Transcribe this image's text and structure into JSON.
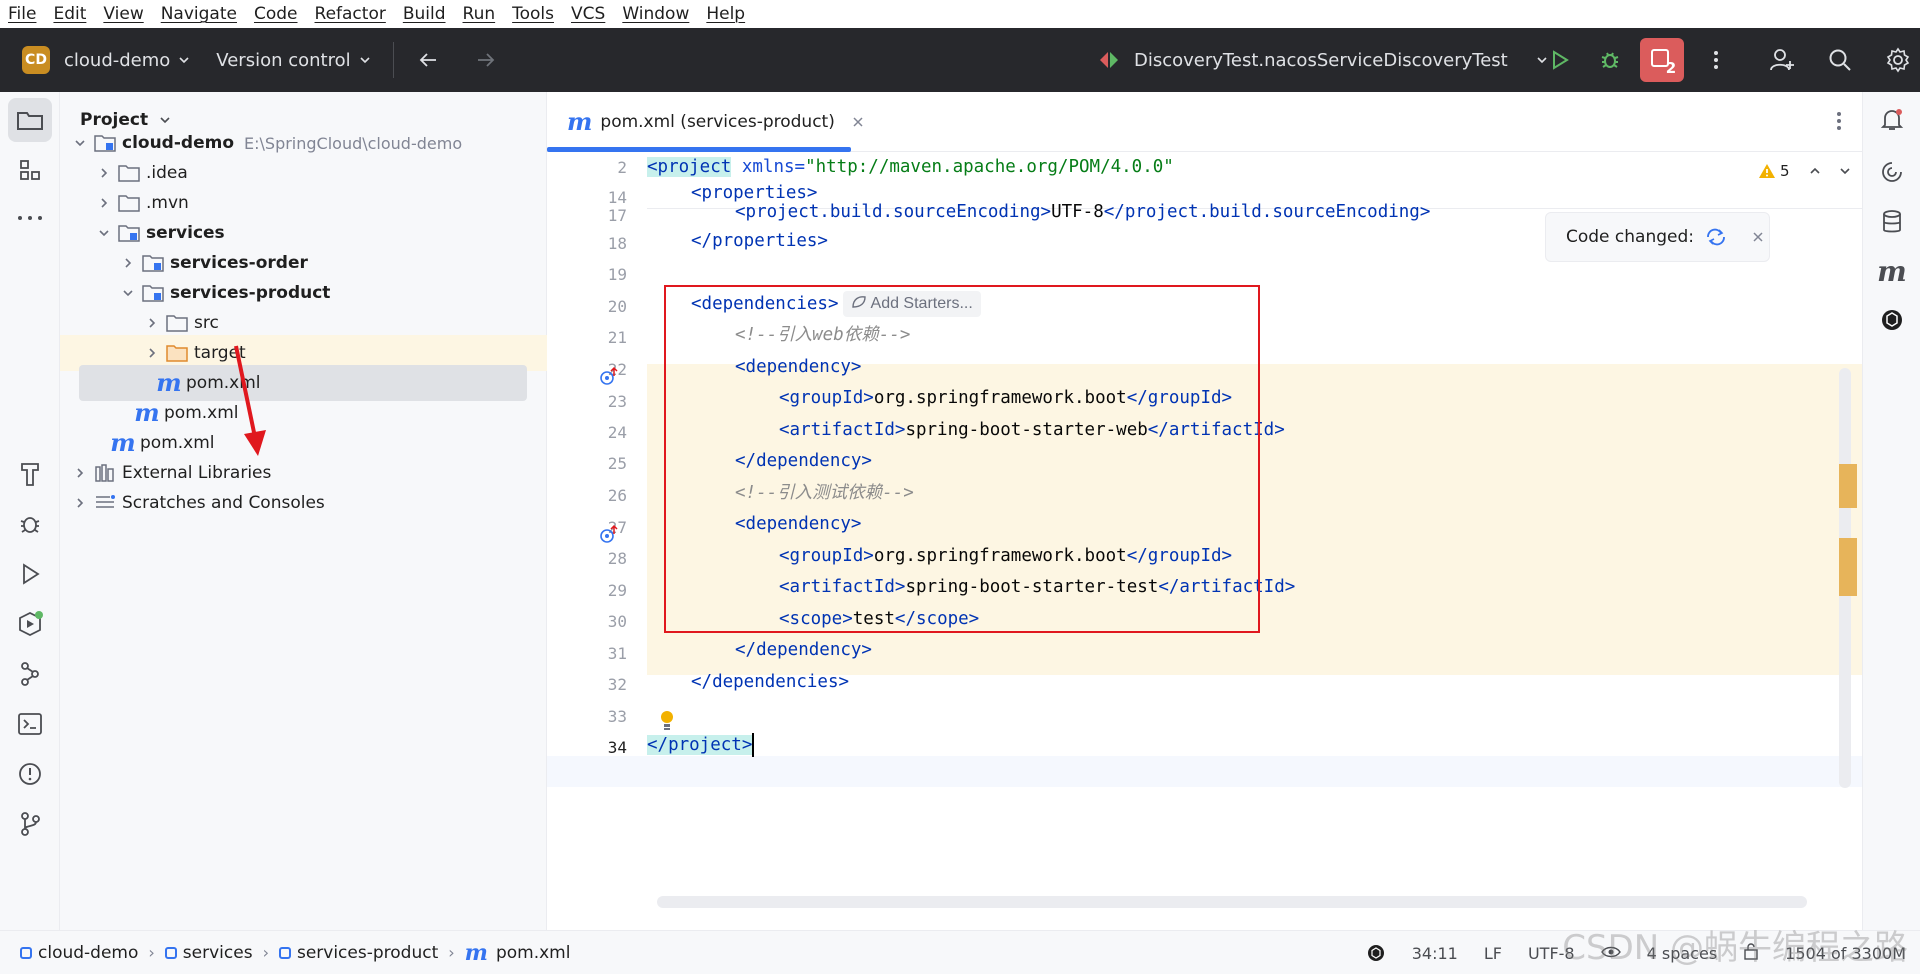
{
  "menu": [
    "File",
    "Edit",
    "View",
    "Navigate",
    "Code",
    "Refactor",
    "Build",
    "Run",
    "Tools",
    "VCS",
    "Window",
    "Help"
  ],
  "toolbar": {
    "project_badge": "CD",
    "project_name": "cloud-demo",
    "version_control": "Version control",
    "run_config": "DiscoveryTest.nacosServiceDiscoveryTest",
    "record_count": "2"
  },
  "project_panel": {
    "title": "Project",
    "tree": [
      {
        "label": "cloud-demo",
        "path": "E:\\SpringCloud\\cloud-demo"
      },
      {
        "label": ".idea"
      },
      {
        "label": ".mvn"
      },
      {
        "label": "services"
      },
      {
        "label": "services-order"
      },
      {
        "label": "services-product"
      },
      {
        "label": "src"
      },
      {
        "label": "target"
      },
      {
        "label": "pom.xml"
      },
      {
        "label": "pom.xml"
      },
      {
        "label": "pom.xml"
      },
      {
        "label": "External Libraries"
      },
      {
        "label": "Scratches and Consoles"
      }
    ]
  },
  "editor": {
    "tab_label": "pom.xml (services-product)",
    "warning_count": "5",
    "code_changed": "Code changed:",
    "add_starters": "Add Starters...",
    "line_numbers": [
      "2",
      "14",
      "17",
      "18",
      "19",
      "20",
      "21",
      "22",
      "23",
      "24",
      "25",
      "26",
      "27",
      "28",
      "29",
      "30",
      "31",
      "32",
      "33",
      "34"
    ],
    "lines": {
      "l2_tag": "<project",
      "l2_attr": " xmlns=",
      "l2_str": "\"http://maven.apache.org/POM/4.0.0\"",
      "l14": "<properties>",
      "l17_open": "<project.build.sourceEncoding>",
      "l17_val": "UTF-8",
      "l17_close": "</project.build.sourceEncoding>",
      "l18": "</properties>",
      "l20": "<dependencies>",
      "l21": "<!--引入web依赖-->",
      "l22": "<dependency>",
      "l23_open": "<groupId>",
      "l23_val": "org.springframework.boot",
      "l23_close": "</groupId>",
      "l24_open": "<artifactId>",
      "l24_val": "spring-boot-starter-web",
      "l24_close": "</artifactId>",
      "l25": "</dependency>",
      "l26": "<!--引入测试依赖-->",
      "l27": "<dependency>",
      "l28_open": "<groupId>",
      "l28_val": "org.springframework.boot",
      "l28_close": "</groupId>",
      "l29_open": "<artifactId>",
      "l29_val": "spring-boot-starter-test",
      "l29_close": "</artifactId>",
      "l30_open": "<scope>",
      "l30_val": "test",
      "l30_close": "</scope>",
      "l31": "</dependency>",
      "l32": "</dependencies>",
      "l34": "</project>"
    }
  },
  "statusbar": {
    "crumbs": [
      "cloud-demo",
      "services",
      "services-product",
      "pom.xml"
    ],
    "position": "34:11",
    "line_sep": "LF",
    "encoding": "UTF-8",
    "indent": "4 spaces",
    "memory": "1504 of 3300M"
  },
  "watermark": "CSDN @蜗牛编程之路",
  "colors": {
    "accent": "#3574f0",
    "toolbar_bg": "#27282c",
    "highlight": "#e0181e"
  }
}
